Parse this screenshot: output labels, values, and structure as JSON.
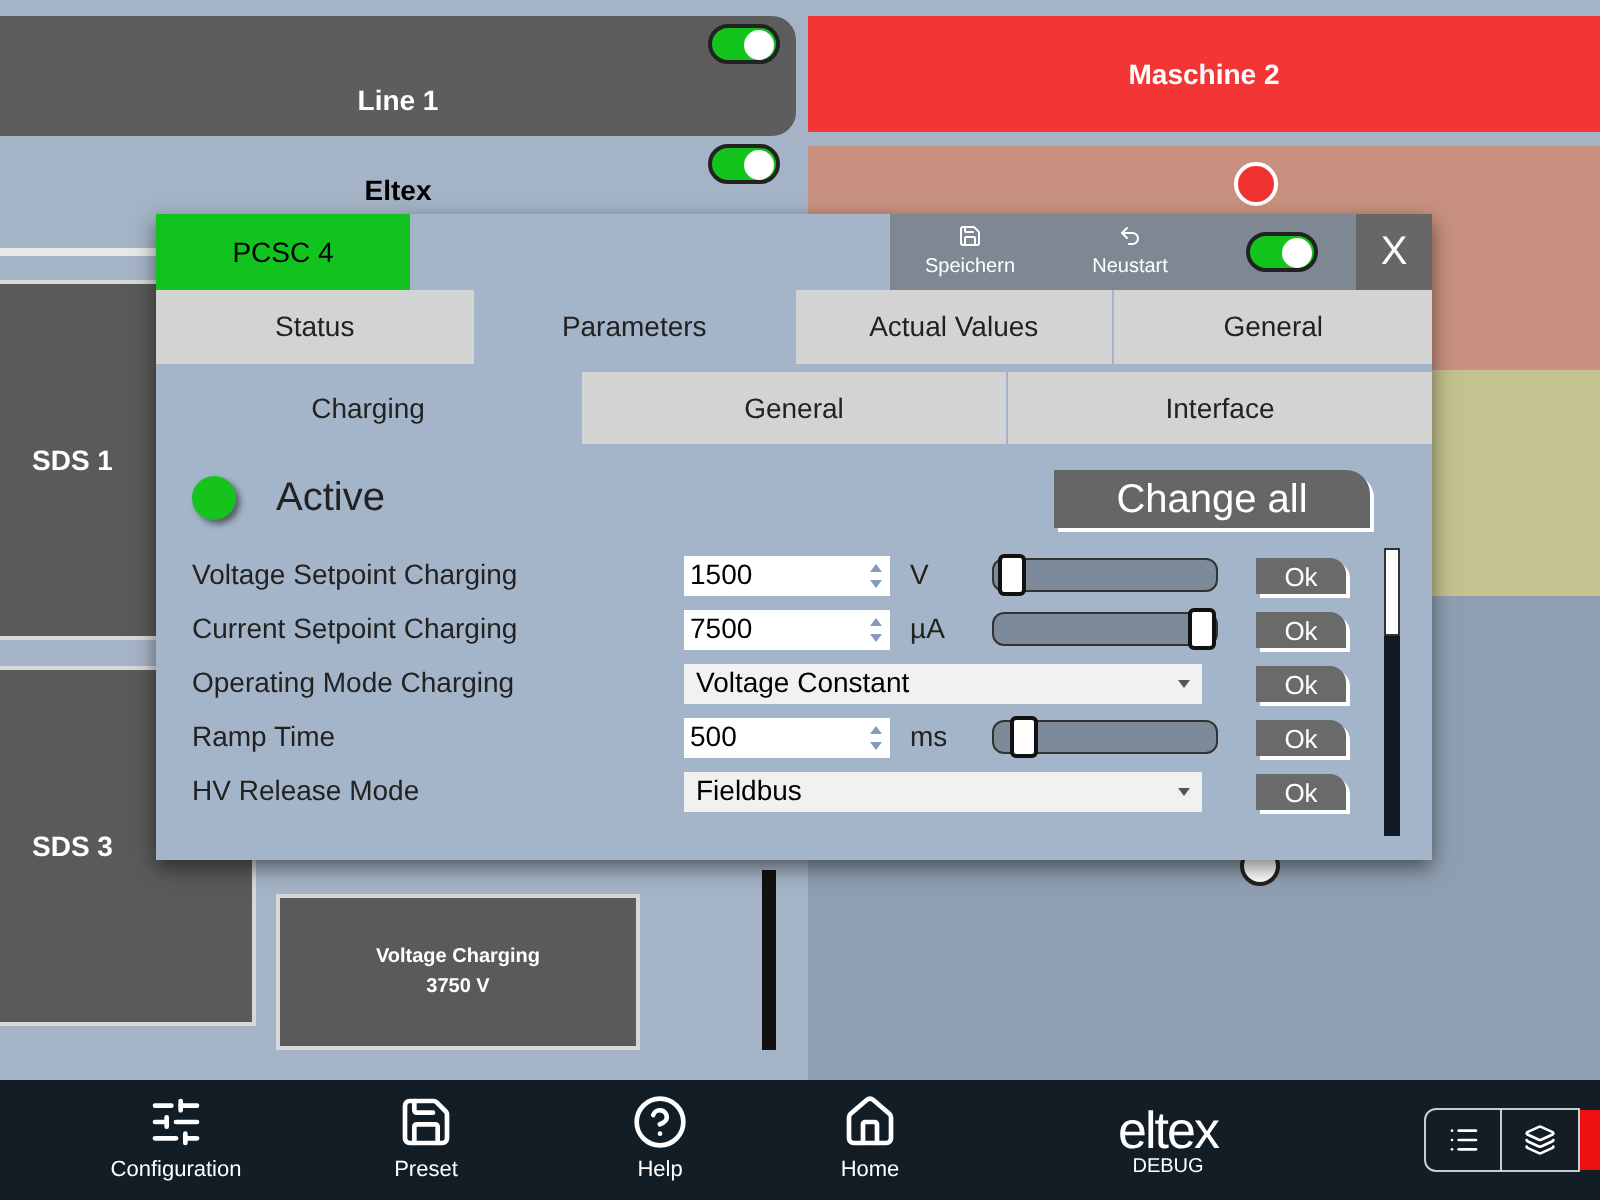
{
  "left_panel": {
    "line_card": {
      "title": "Line 1",
      "on": true
    },
    "group": {
      "title": "Eltex",
      "on": true
    },
    "tiles": [
      {
        "title": "SDS 1"
      },
      {
        "title": "SDS 3"
      }
    ],
    "voltage_tile": {
      "caption": "Voltage Charging",
      "value": "3750 V"
    }
  },
  "right_panel": {
    "machine_card": {
      "title": "Maschine 2"
    }
  },
  "dialog": {
    "title": "PCSC 4",
    "toolbar": [
      {
        "label": "Speichern",
        "kind": "save"
      },
      {
        "label": "Neustart",
        "kind": "restart"
      }
    ],
    "enabled": true,
    "close": "X",
    "tabs": [
      {
        "label": "Status",
        "selected": false
      },
      {
        "label": "Parameters",
        "selected": true
      },
      {
        "label": "Actual Values",
        "selected": false
      },
      {
        "label": "General",
        "selected": false
      }
    ],
    "subtabs": [
      {
        "label": "Charging",
        "selected": true
      },
      {
        "label": "General",
        "selected": false
      },
      {
        "label": "Interface",
        "selected": false
      }
    ],
    "active": {
      "label": "Active",
      "on": true
    },
    "change_all": "Change all",
    "params": [
      {
        "kind": "number",
        "label": "Voltage Setpoint Charging",
        "value": "1500",
        "unit": "V",
        "level": 0.02,
        "ok": "Ok"
      },
      {
        "kind": "number",
        "label": "Current Setpoint Charging",
        "value": "7500",
        "unit": "µA",
        "level": 1,
        "ok": "Ok"
      },
      {
        "kind": "select",
        "label": "Operating Mode Charging",
        "value": "Voltage Constant",
        "ok": "Ok"
      },
      {
        "kind": "number",
        "label": "Ramp Time",
        "value": "500",
        "unit": "ms",
        "level": 0.08,
        "ok": "Ok"
      },
      {
        "kind": "select",
        "label": "HV Release Mode",
        "value": "Fieldbus",
        "ok": "Ok"
      }
    ]
  },
  "bottom_bar": {
    "items": [
      {
        "label": "Configuration",
        "kind": "sliders"
      },
      {
        "label": "Preset",
        "kind": "save"
      },
      {
        "label": "Help",
        "kind": "help"
      },
      {
        "label": "Home",
        "kind": "home"
      }
    ],
    "logo": {
      "text": "eltex",
      "subtitle": "DEBUG"
    }
  }
}
